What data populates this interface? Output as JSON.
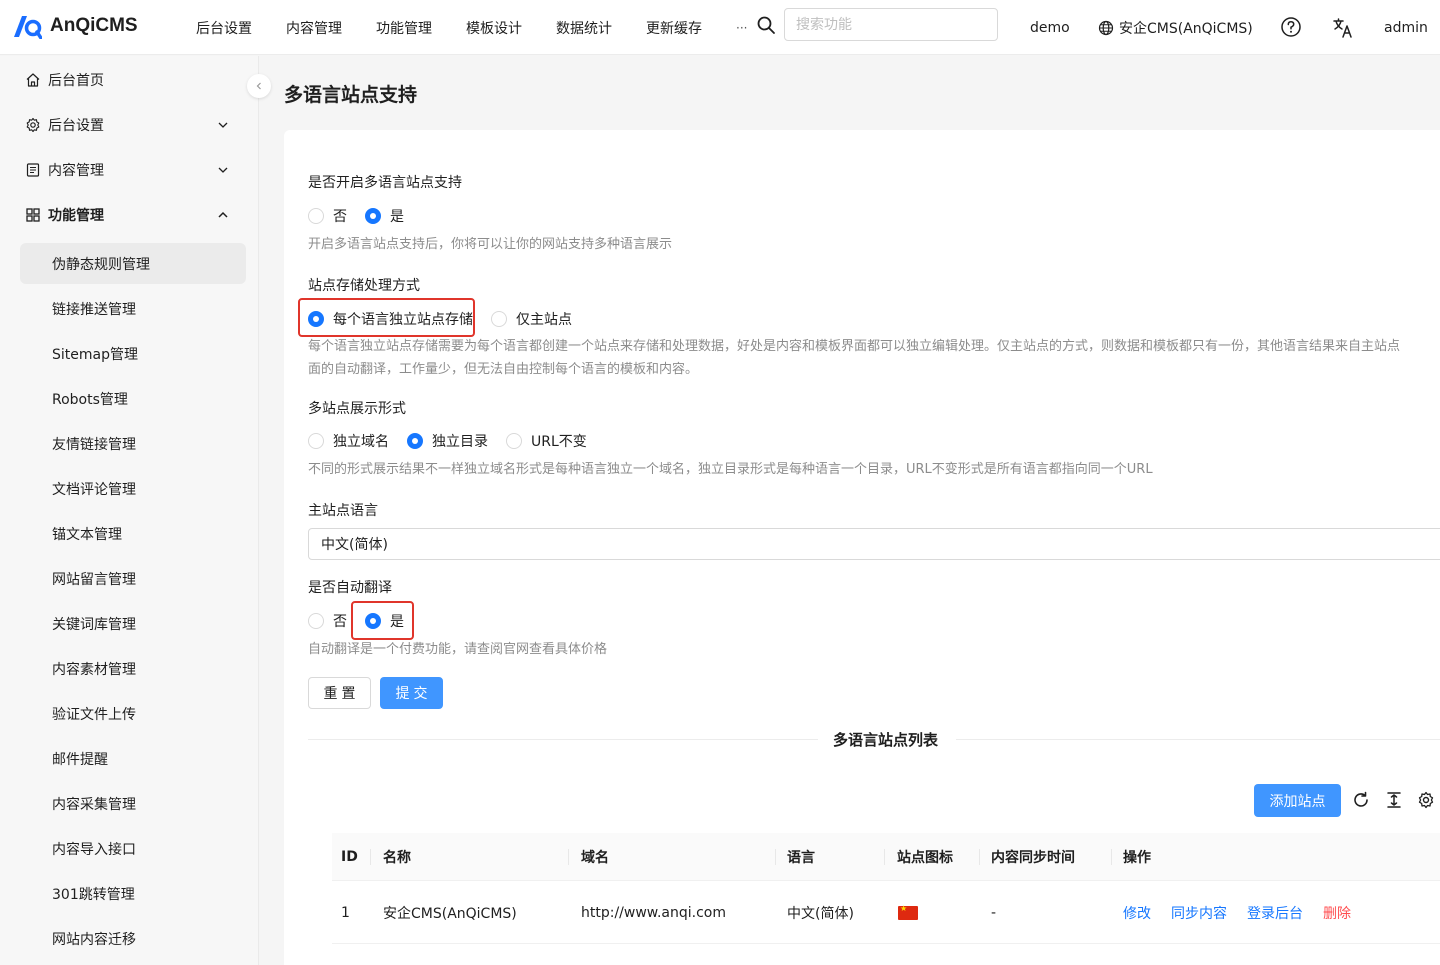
{
  "header": {
    "logo_text": "AnQiCMS",
    "nav": [
      "后台设置",
      "内容管理",
      "功能管理",
      "模板设计",
      "数据统计",
      "更新缓存",
      "···"
    ],
    "search_placeholder": "搜索功能",
    "site_label": "demo",
    "site_name": "安企CMS(AnQiCMS)",
    "user": "admin"
  },
  "sidebar": {
    "items": [
      {
        "label": "后台首页",
        "icon": "home-icon"
      },
      {
        "label": "后台设置",
        "icon": "gear-icon"
      },
      {
        "label": "内容管理",
        "icon": "document-icon"
      },
      {
        "label": "功能管理",
        "icon": "grid-icon"
      }
    ],
    "sub_items": [
      "伪静态规则管理",
      "链接推送管理",
      "Sitemap管理",
      "Robots管理",
      "友情链接管理",
      "文档评论管理",
      "锚文本管理",
      "网站留言管理",
      "关键词库管理",
      "内容素材管理",
      "验证文件上传",
      "邮件提醒",
      "内容采集管理",
      "内容导入接口",
      "301跳转管理",
      "网站内容迁移"
    ]
  },
  "page": {
    "title": "多语言站点支持"
  },
  "form": {
    "enable": {
      "label": "是否开启多语言站点支持",
      "options": [
        "否",
        "是"
      ],
      "selected": "是",
      "help": "开启多语言站点支持后，你将可以让你的网站支持多种语言展示"
    },
    "storage": {
      "label": "站点存储处理方式",
      "options": [
        "每个语言独立站点存储",
        "仅主站点"
      ],
      "selected": "每个语言独立站点存储",
      "help_line1": "每个语言独立站点存储需要为每个语言都创建一个站点来存储和处理数据，好处是内容和模板界面都可以独立编辑处理。仅主站点的方式，则数据和模板都只有一份，其他语言结果来自主站点",
      "help_line2": "面的自动翻译，工作量少，但无法自由控制每个语言的模板和内容。"
    },
    "display": {
      "label": "多站点展示形式",
      "options": [
        "独立域名",
        "独立目录",
        "URL不变"
      ],
      "selected": "独立目录",
      "help": "不同的形式展示结果不一样独立域名形式是每种语言独立一个域名，独立目录形式是每种语言一个目录，URL不变形式是所有语言都指向同一个URL"
    },
    "main_language": {
      "label": "主站点语言",
      "value": "中文(简体)"
    },
    "auto_translate": {
      "label": "是否自动翻译",
      "options": [
        "否",
        "是"
      ],
      "selected": "是",
      "help": "自动翻译是一个付费功能，请查阅官网查看具体价格"
    },
    "reset_label": "重置",
    "submit_label": "提交"
  },
  "site_list": {
    "title": "多语言站点列表",
    "add_label": "添加站点",
    "columns": [
      "ID",
      "名称",
      "域名",
      "语言",
      "站点图标",
      "内容同步时间",
      "操作"
    ],
    "rows": [
      {
        "id": "1",
        "name": "安企CMS(AnQiCMS)",
        "domain": "http://www.anqi.com",
        "language": "中文(简体)",
        "sync_time": "-",
        "actions": [
          "修改",
          "同步内容",
          "登录后台",
          "删除"
        ]
      }
    ]
  },
  "colors": {
    "primary": "#1677ff",
    "button": "#4096ff",
    "danger": "#ff4d4f",
    "highlight": "#e0352b"
  }
}
